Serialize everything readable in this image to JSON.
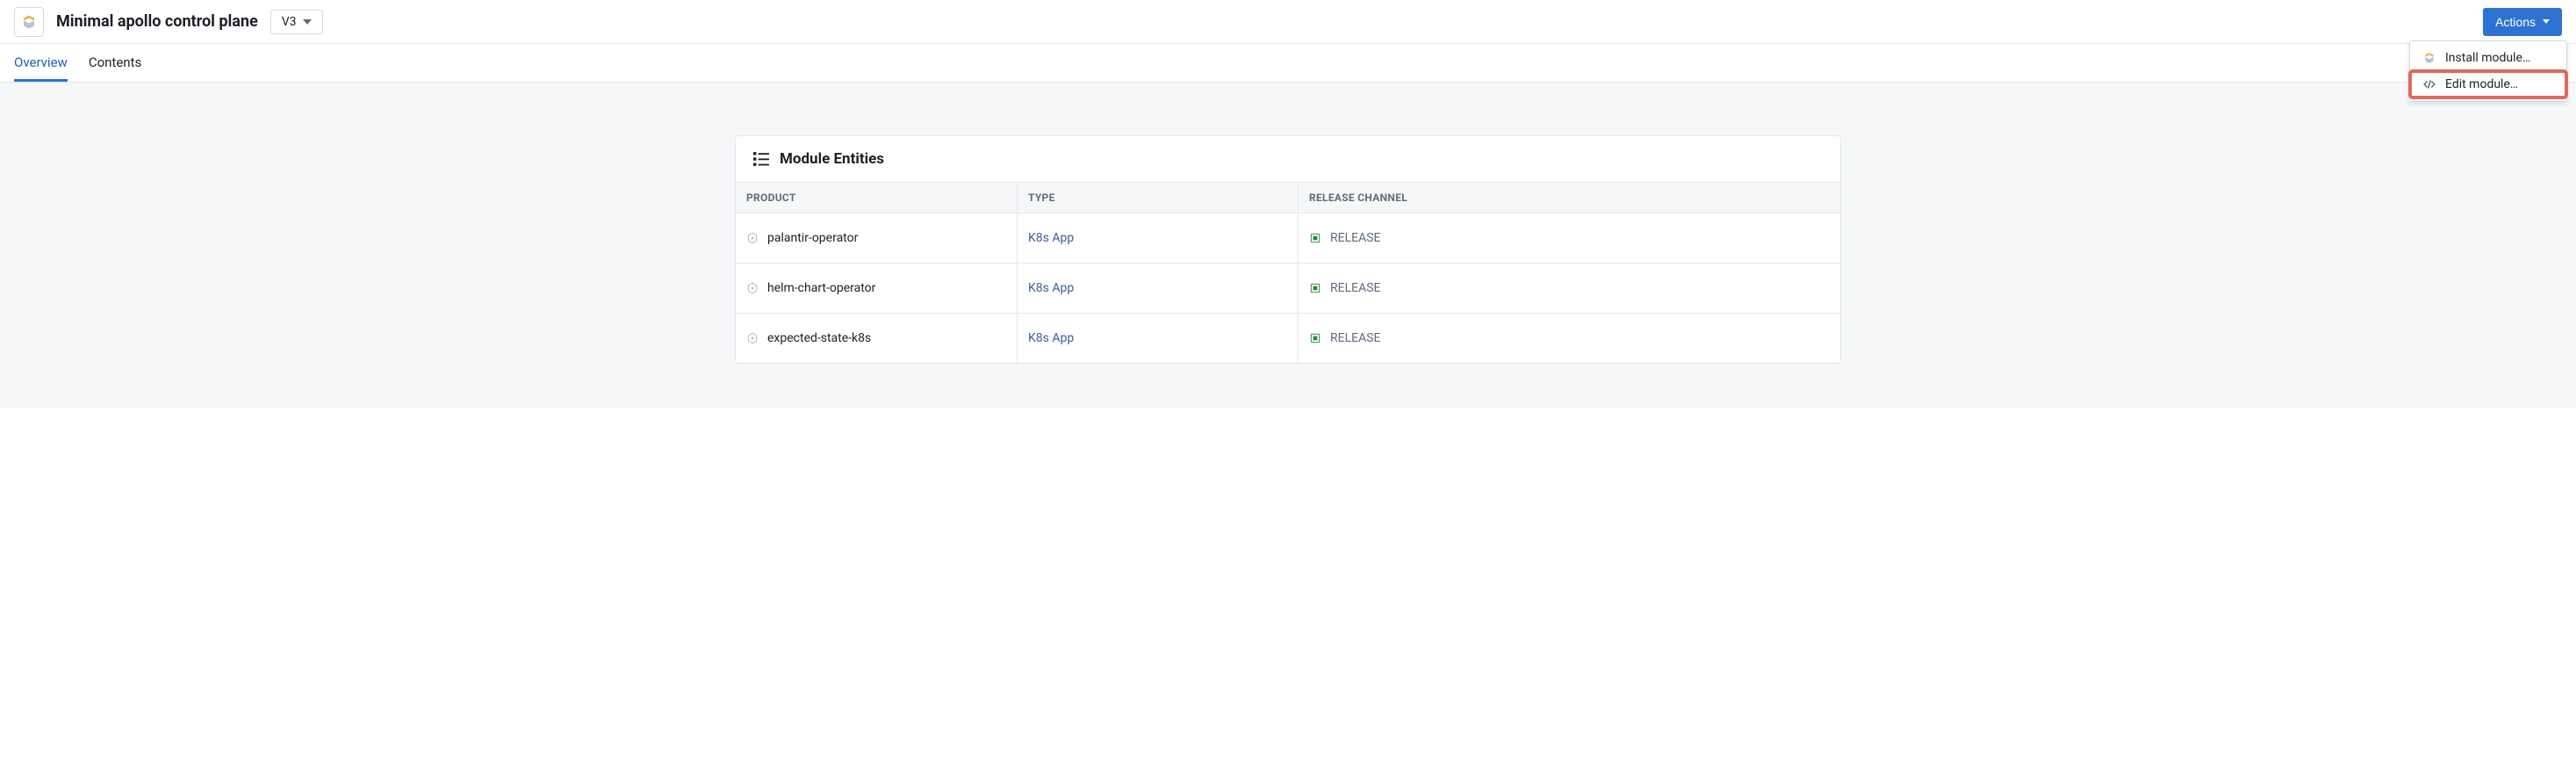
{
  "header": {
    "title": "Minimal apollo control plane",
    "version": "V3",
    "actions_label": "Actions",
    "menu": {
      "install": "Install module…",
      "edit": "Edit module…"
    }
  },
  "tabs": {
    "overview": "Overview",
    "contents": "Contents"
  },
  "entities_card": {
    "title": "Module Entities",
    "columns": {
      "product": "PRODUCT",
      "type": "TYPE",
      "channel": "RELEASE CHANNEL"
    },
    "rows": [
      {
        "product": "palantir-operator",
        "type": "K8s App",
        "channel": "RELEASE"
      },
      {
        "product": "helm-chart-operator",
        "type": "K8s App",
        "channel": "RELEASE"
      },
      {
        "product": "expected-state-k8s",
        "type": "K8s App",
        "channel": "RELEASE"
      }
    ]
  }
}
